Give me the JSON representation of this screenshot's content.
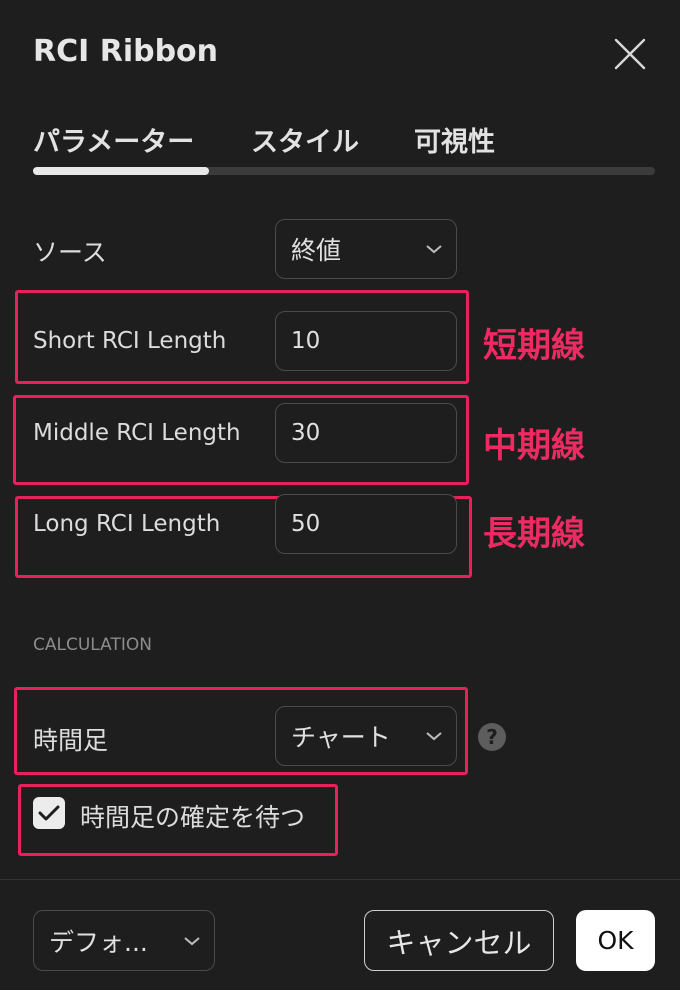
{
  "dialog": {
    "title": "RCI Ribbon"
  },
  "tabs": [
    {
      "label": "パラメーター",
      "active": true
    },
    {
      "label": "スタイル",
      "active": false
    },
    {
      "label": "可視性",
      "active": false
    }
  ],
  "fields": {
    "source": {
      "label": "ソース",
      "value": "終値"
    },
    "short": {
      "label": "Short RCI Length",
      "value": "10",
      "annotation": "短期線"
    },
    "middle": {
      "label": "Middle RCI Length",
      "value": "30",
      "annotation": "中期線"
    },
    "long": {
      "label": "Long RCI Length",
      "value": "50",
      "annotation": "長期線"
    }
  },
  "calculation": {
    "section_label": "CALCULATION",
    "timeframe": {
      "label": "時間足",
      "value": "チャート",
      "help_icon": "?"
    },
    "wait_confirm": {
      "label": "時間足の確定を待つ",
      "checked": true
    }
  },
  "footer": {
    "defaults_label": "デフォ...",
    "cancel_label": "キャンセル",
    "ok_label": "OK"
  },
  "colors": {
    "background": "#1e1e1e",
    "highlight": "#e8205c",
    "annotation_text": "#ee2a62",
    "ok_button": "#ffffff"
  }
}
